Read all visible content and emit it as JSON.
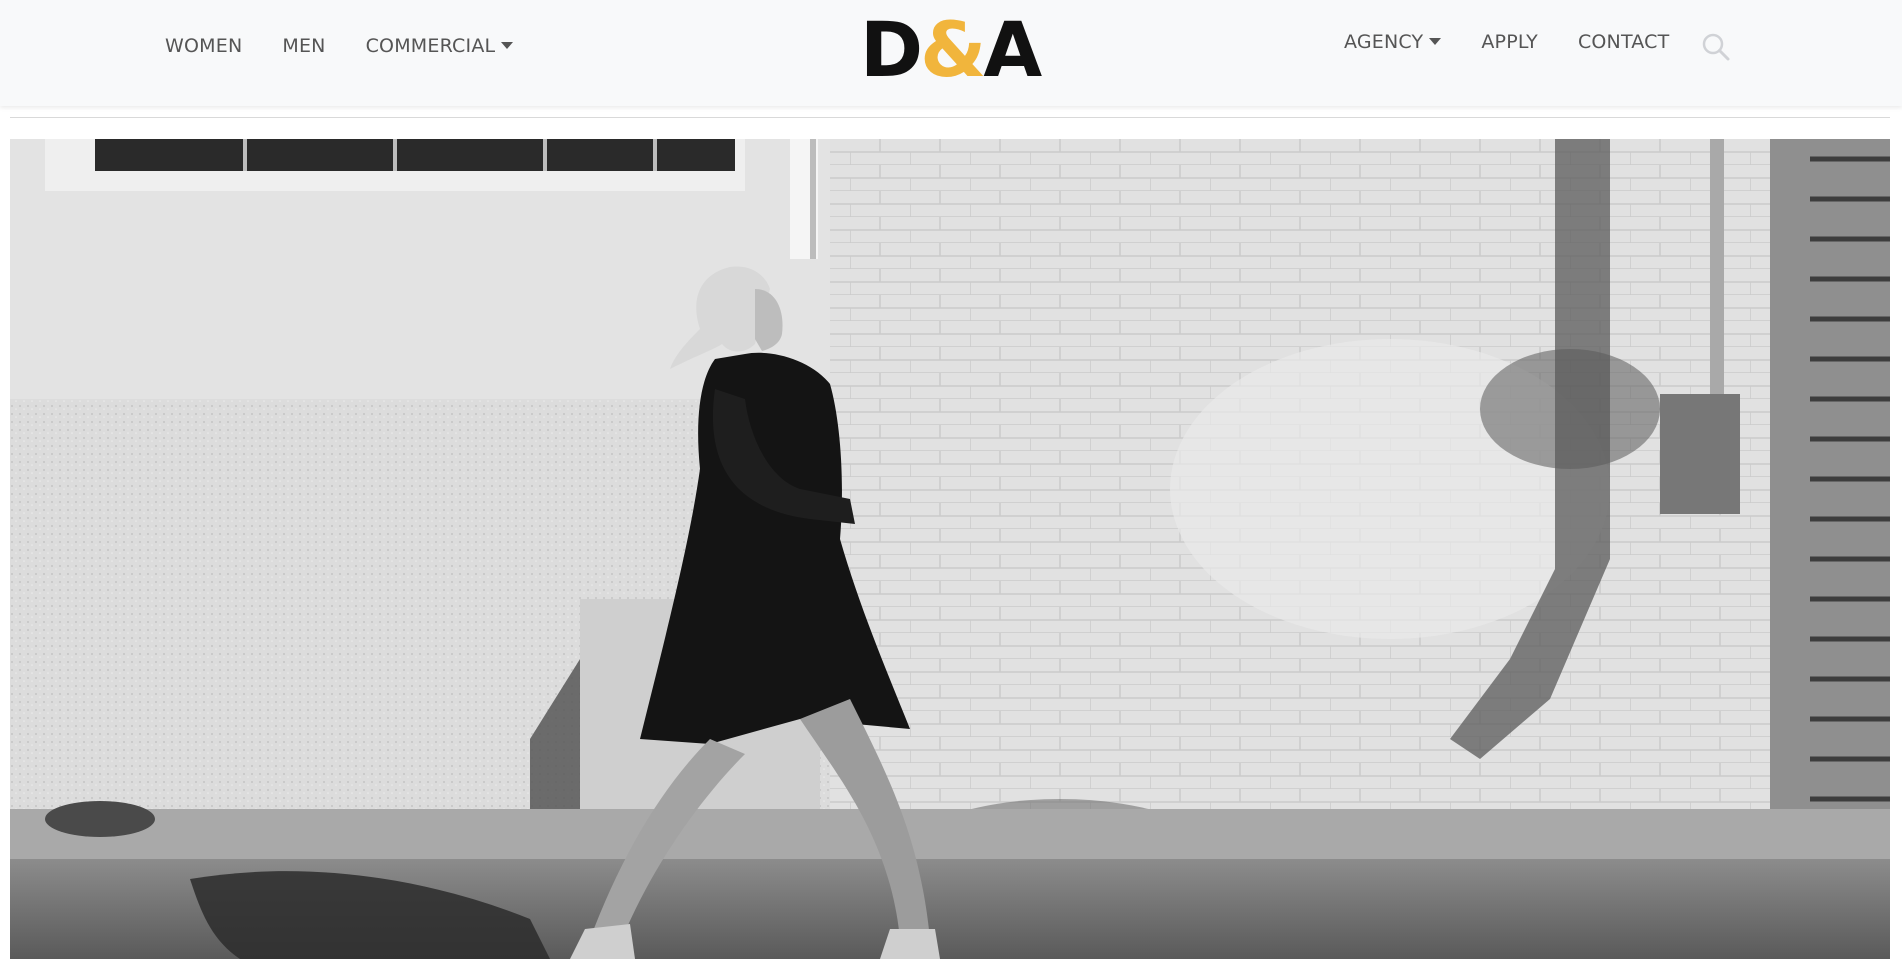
{
  "nav": {
    "left": [
      {
        "label": "WOMEN"
      },
      {
        "label": "MEN"
      },
      {
        "label": "COMMERCIAL",
        "dropdown": true
      }
    ],
    "right": [
      {
        "label": "AGENCY",
        "dropdown": true
      },
      {
        "label": "APPLY"
      },
      {
        "label": "CONTACT"
      }
    ],
    "search_icon": "search-icon"
  },
  "logo": {
    "part1": "D",
    "part2": "&",
    "part3": "A",
    "colors": {
      "letters": "#111111",
      "ampersand": "#f1b53c"
    }
  },
  "hero": {
    "image": "black-and-white photo of a blonde model in a long black coat walking past a whitewashed brick wall"
  }
}
